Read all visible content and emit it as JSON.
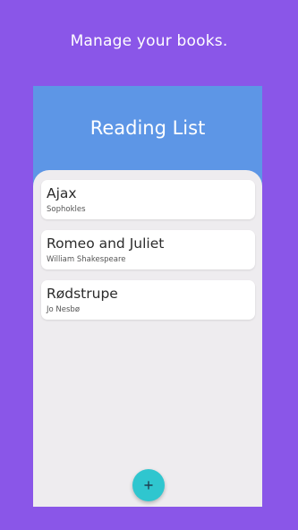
{
  "tagline": "Manage your books.",
  "app": {
    "title": "Reading List"
  },
  "books": [
    {
      "title": "Ajax",
      "author": "Sophokles"
    },
    {
      "title": "Romeo and Juliet",
      "author": "William Shakespeare"
    },
    {
      "title": "Rødstrupe",
      "author": "Jo Nesbø"
    }
  ],
  "fab": {
    "icon": "plus-icon"
  },
  "colors": {
    "background": "#8a56e8",
    "header": "#5d96e6",
    "fab": "#2fc6cf",
    "screen": "#eeecef"
  }
}
